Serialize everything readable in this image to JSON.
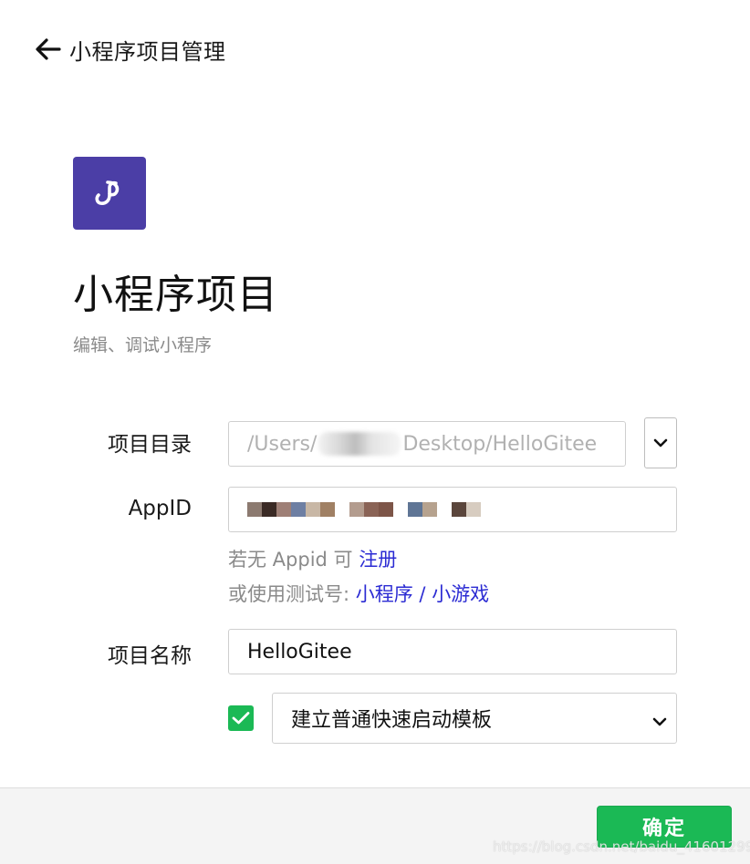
{
  "header": {
    "back_icon": "arrow-left-icon",
    "title": "小程序项目管理"
  },
  "logo": {
    "icon": "mini-program-logo-icon",
    "bg_color": "#4b3ea6"
  },
  "main": {
    "title": "小程序项目",
    "subtitle": "编辑、调试小程序"
  },
  "form": {
    "directory": {
      "label": "项目目录",
      "value_prefix": "/Users/",
      "value_suffix": "Desktop/HelloGitee"
    },
    "appid": {
      "label": "AppID"
    },
    "hint": {
      "line1_prefix": "若无 Appid 可 ",
      "register_link": "注册",
      "line2_prefix": "或使用测试号: ",
      "miniprogram_link": "小程序",
      "separator": " / ",
      "minigame_link": "小游戏"
    },
    "name": {
      "label": "项目名称",
      "value": "HelloGitee"
    },
    "template": {
      "checked": true,
      "selected": "建立普通快速启动模板"
    }
  },
  "footer": {
    "confirm_label": "确定",
    "confirm_color": "#1bb955"
  },
  "watermark": "https://blog.csdn.net/baidu_41601299"
}
